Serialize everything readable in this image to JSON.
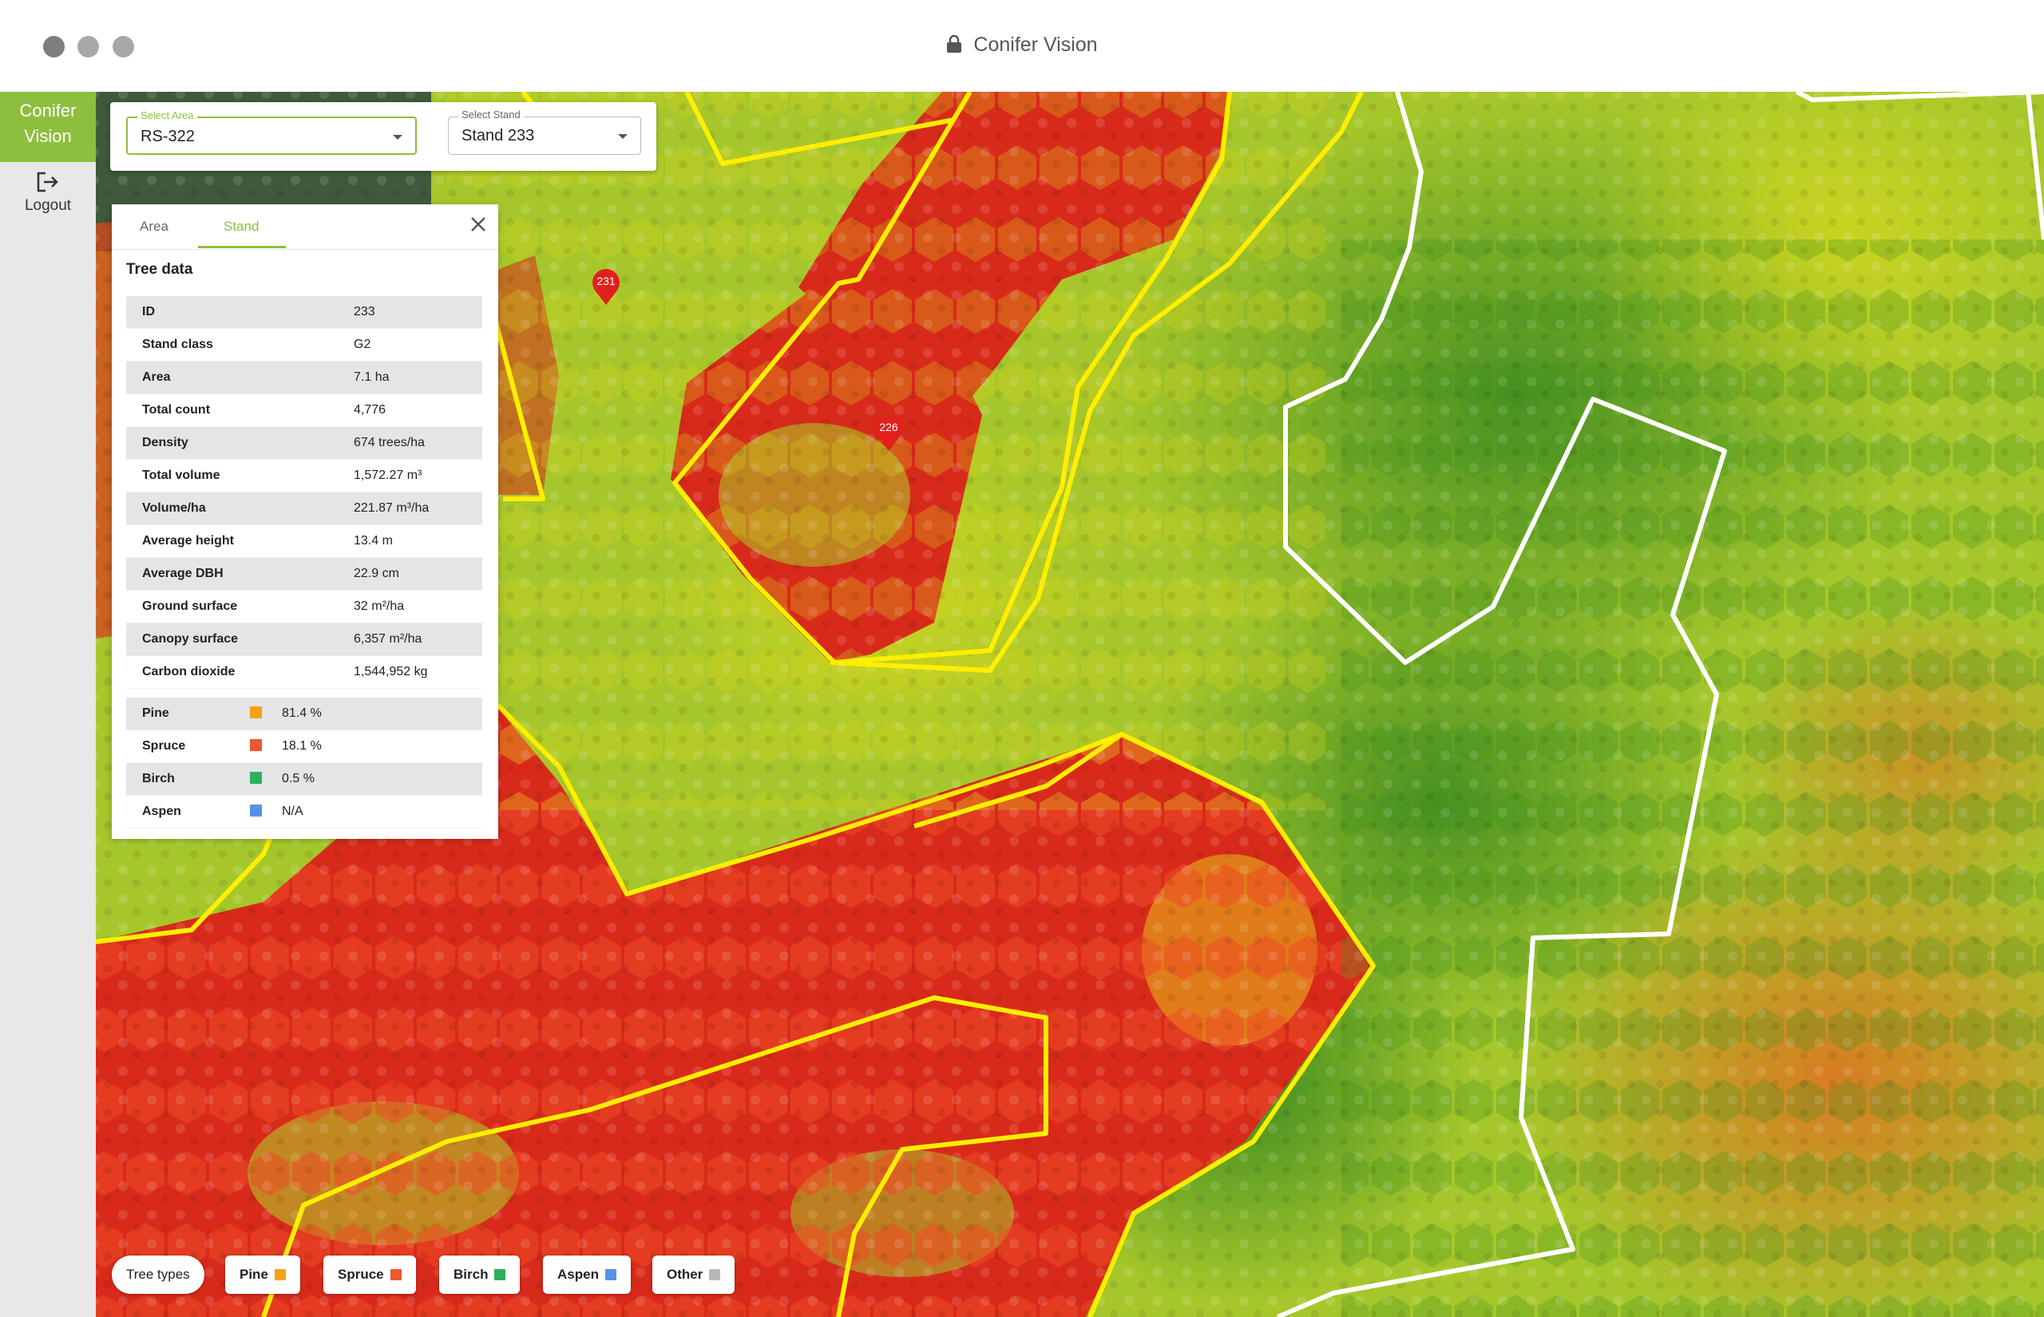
{
  "window": {
    "title": "Conifer Vision"
  },
  "sidebar": {
    "brand_line1": "Conifer",
    "brand_line2": "Vision",
    "logout_label": "Logout"
  },
  "selectors": {
    "area": {
      "label": "Select Area",
      "value": "RS-322"
    },
    "stand": {
      "label": "Select Stand",
      "value": "Stand 233"
    }
  },
  "panel": {
    "tabs": [
      "Area",
      "Stand"
    ],
    "active_tab": "Stand",
    "title": "Tree data",
    "rows": [
      {
        "label": "ID",
        "value": "233"
      },
      {
        "label": "Stand class",
        "value": "G2"
      },
      {
        "label": "Area",
        "value": "7.1 ha"
      },
      {
        "label": "Total count",
        "value": "4,776"
      },
      {
        "label": "Density",
        "value": "674 trees/ha"
      },
      {
        "label": "Total volume",
        "value": "1,572.27 m³"
      },
      {
        "label": "Volume/ha",
        "value": "221.87 m³/ha"
      },
      {
        "label": "Average height",
        "value": "13.4 m"
      },
      {
        "label": "Average DBH",
        "value": "22.9 cm"
      },
      {
        "label": "Ground surface",
        "value": "32 m²/ha"
      },
      {
        "label": "Canopy surface",
        "value": "6,357 m²/ha"
      },
      {
        "label": "Carbon dioxide",
        "value": "1,544,952 kg"
      }
    ],
    "species": [
      {
        "label": "Pine",
        "value": "81.4 %",
        "color": "#f4a219"
      },
      {
        "label": "Spruce",
        "value": "18.1 %",
        "color": "#ea5a2e"
      },
      {
        "label": "Birch",
        "value": "0.5 %",
        "color": "#2fae5c"
      },
      {
        "label": "Aspen",
        "value": "N/A",
        "color": "#5b8fe8"
      }
    ]
  },
  "markers": [
    {
      "label": "231"
    },
    {
      "label": "226"
    }
  ],
  "legend": {
    "title": "Tree types",
    "items": [
      {
        "label": "Pine",
        "color": "#f4a219"
      },
      {
        "label": "Spruce",
        "color": "#ea5a2e"
      },
      {
        "label": "Birch",
        "color": "#2fae5c"
      },
      {
        "label": "Aspen",
        "color": "#5b8fe8"
      },
      {
        "label": "Other",
        "color": "#b8b8b8"
      }
    ]
  },
  "colors": {
    "accent": "#8dbf3f",
    "stand_outline": "#ffee00",
    "area_outline": "#ffffff",
    "high_density": "#d9261c",
    "low_density": "#2e8b1e"
  }
}
